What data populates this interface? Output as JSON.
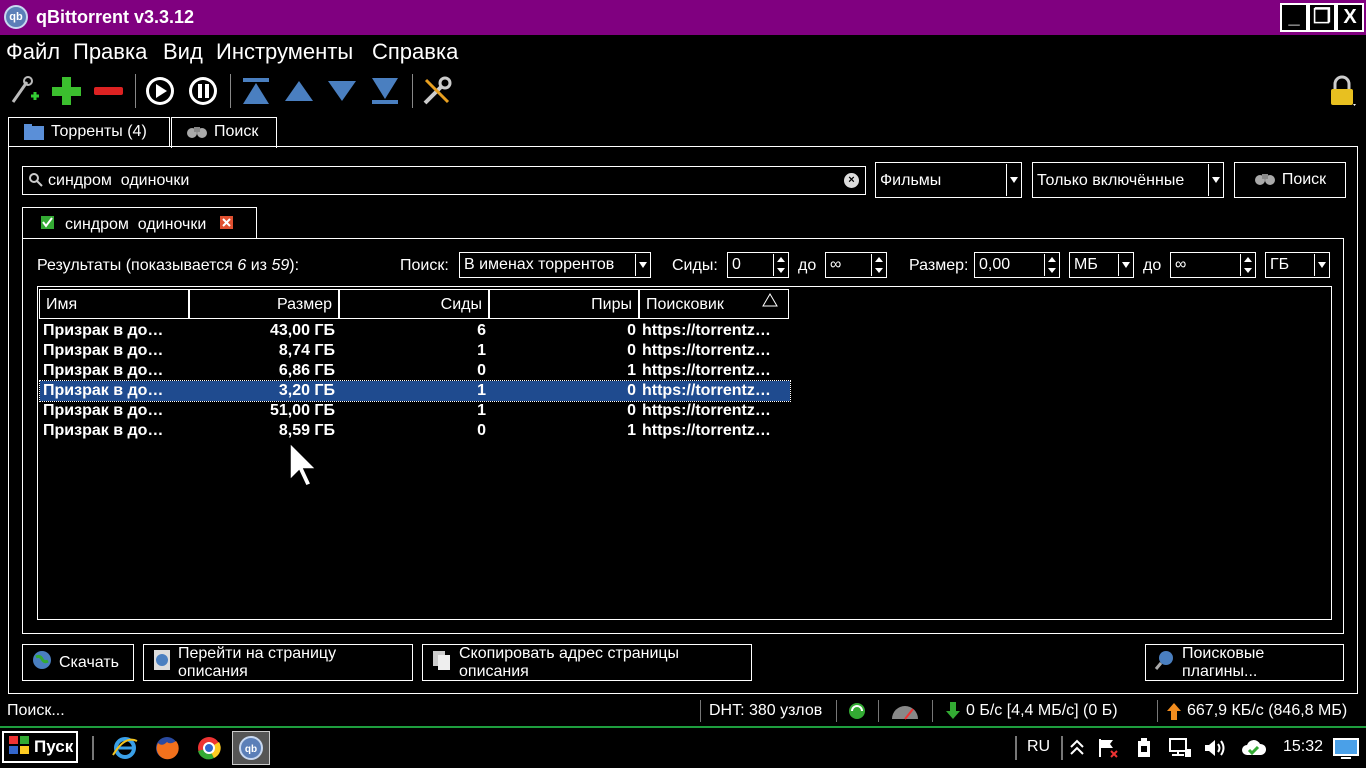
{
  "window": {
    "title": "qBittorrent v3.3.12",
    "app_icon_text": "qb",
    "controls": {
      "minimize": "_",
      "maximize": "❐",
      "close": "X"
    }
  },
  "menu": [
    "Файл",
    "Правка",
    "Вид",
    "Инструменты",
    "Справка"
  ],
  "toolbar": {
    "icons": [
      "add-link-icon",
      "add-torrent-icon",
      "remove-icon",
      "resume-icon",
      "pause-icon",
      "move-top-icon",
      "move-up-icon",
      "move-down-icon",
      "move-bottom-icon",
      "settings-icon",
      "lock-icon"
    ]
  },
  "tabs": {
    "torrents": "Торренты (4)",
    "search": "Поиск"
  },
  "search": {
    "query": "синдром  одиночки",
    "category": "Фильмы",
    "plugins": "Только включённые",
    "button": "Поиск"
  },
  "result_tab": {
    "label": "синдром  одиночки"
  },
  "filters": {
    "results_prefix": "Результаты (показывается ",
    "shown": "6",
    "of": " из ",
    "total": "59",
    "results_suffix": "):",
    "search_in_label": "Поиск:",
    "search_in_value": "В именах торрентов",
    "seeds_label": "Сиды:",
    "seeds_min": "0",
    "to1": "до",
    "seeds_max": "∞",
    "size_label": "Размер:",
    "size_min": "0,00",
    "size_min_unit": "МБ",
    "to2": "до",
    "size_max": "∞",
    "size_max_unit": "ГБ"
  },
  "table": {
    "columns": [
      "Имя",
      "Размер",
      "Сиды",
      "Пиры",
      "Поисковик"
    ],
    "rows": [
      {
        "name": "Призрак в до…",
        "size": "43,00 ГБ",
        "seeds": "6",
        "peers": "0",
        "engine": "https://torrentz…",
        "selected": false
      },
      {
        "name": "Призрак в до…",
        "size": "8,74 ГБ",
        "seeds": "1",
        "peers": "0",
        "engine": "https://torrentz…",
        "selected": false
      },
      {
        "name": "Призрак в до…",
        "size": "6,86 ГБ",
        "seeds": "0",
        "peers": "1",
        "engine": "https://torrentz…",
        "selected": false
      },
      {
        "name": "Призрак в до…",
        "size": "3,20 ГБ",
        "seeds": "1",
        "peers": "0",
        "engine": "https://torrentz…",
        "selected": true
      },
      {
        "name": "Призрак в до…",
        "size": "51,00 ГБ",
        "seeds": "1",
        "peers": "0",
        "engine": "https://torrentz…",
        "selected": false
      },
      {
        "name": "Призрак в до…",
        "size": "8,59 ГБ",
        "seeds": "0",
        "peers": "1",
        "engine": "https://torrentz…",
        "selected": false
      }
    ]
  },
  "actions": {
    "download": "Скачать",
    "go_to_description": "Перейти на страницу описания",
    "copy_description_url": "Скопировать адрес страницы описания",
    "search_plugins": "Поисковые плагины..."
  },
  "status": {
    "state": "Поиск...",
    "dht": "DHT: 380 узлов",
    "download": "0 Б/с [4,4 МБ/с] (0 Б)",
    "upload": "667,9 КБ/с (846,8 МБ)"
  },
  "taskbar": {
    "start": "Пуск",
    "apps": [
      "ie-icon",
      "firefox-icon",
      "chrome-icon",
      "qbittorrent-icon"
    ],
    "language": "RU",
    "clock": "15:32"
  },
  "colors": {
    "titlebar": "#800080",
    "selection": "#1f4b8f",
    "taskbar_border": "#1e9e3e"
  }
}
